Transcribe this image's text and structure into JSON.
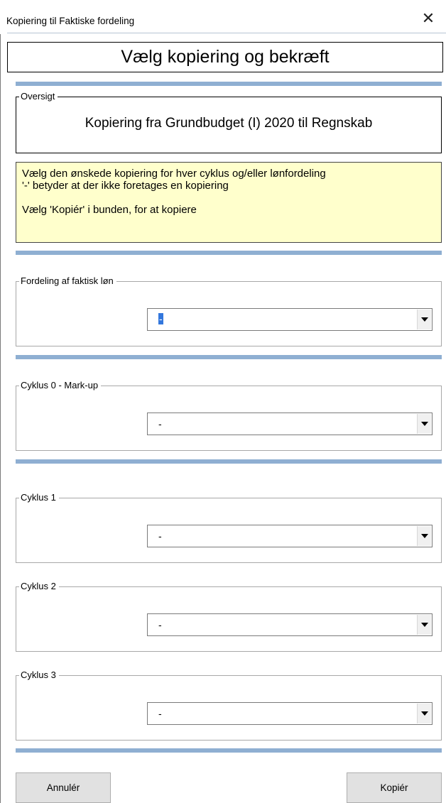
{
  "window": {
    "title": "Kopiering til Faktiske fordeling",
    "close_glyph": "✕"
  },
  "heading": "Vælg kopiering og bekræft",
  "overview": {
    "legend": "Oversigt",
    "text": "Kopiering fra Grundbudget (I) 2020 til Regnskab"
  },
  "info": {
    "line1": "Vælg den ønskede kopiering for hver cyklus og/eller lønfordeling",
    "line2": "'-' betyder at der ikke foretages en kopiering",
    "line3": "Vælg 'Kopiér' i bunden, for at kopiere"
  },
  "groups": [
    {
      "legend": "Fordeling af faktisk løn",
      "value": "-"
    },
    {
      "legend": "Cyklus 0 - Mark-up",
      "value": "-"
    },
    {
      "legend": "Cyklus 1",
      "value": "-"
    },
    {
      "legend": "Cyklus 2",
      "value": "-"
    },
    {
      "legend": "Cyklus 3",
      "value": "-"
    }
  ],
  "buttons": {
    "cancel": "Annulér",
    "copy": "Kopiér"
  },
  "colors": {
    "separator": "#8fafd2",
    "info_background": "#ffffcc",
    "button_background": "#e1e1e1"
  },
  "icons": {
    "close": "close-icon",
    "dropdown": "dropdown-arrow-icon"
  }
}
